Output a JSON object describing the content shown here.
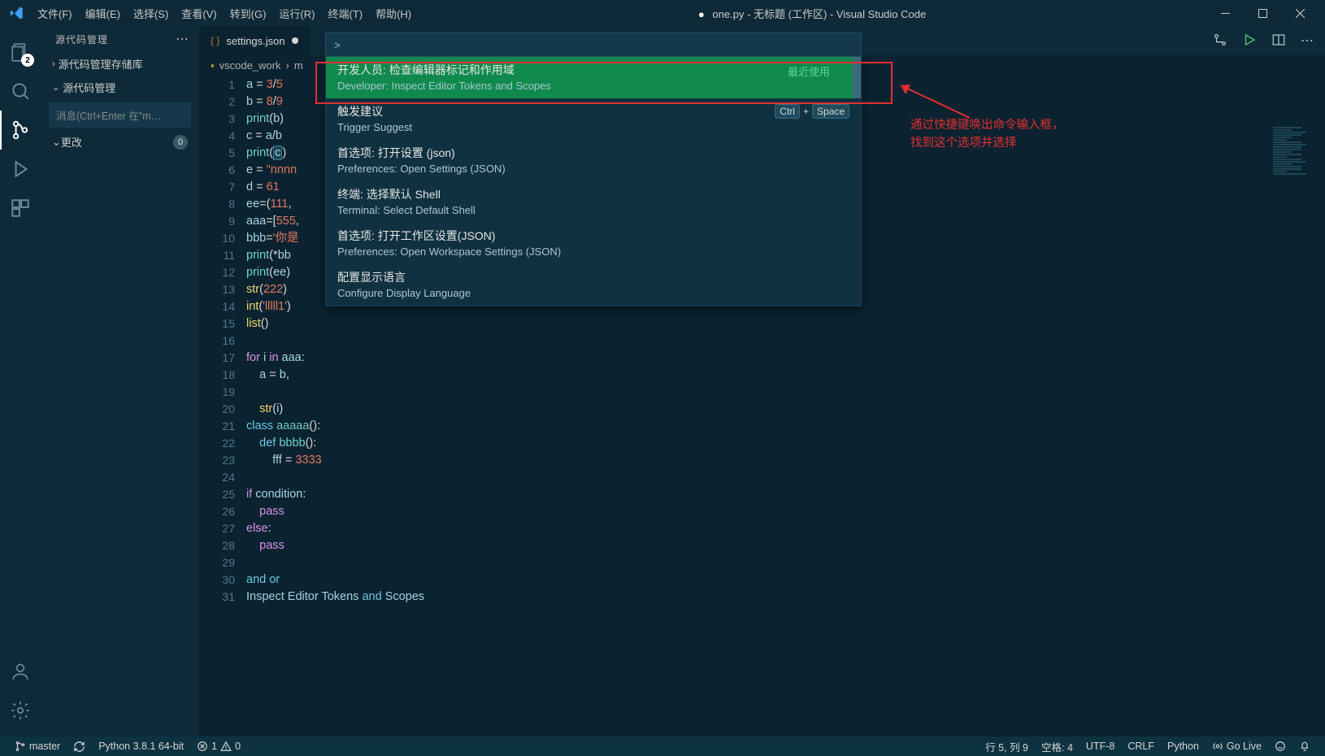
{
  "title": {
    "filename": "one.py",
    "workspace": "无标题 (工作区)",
    "app": "Visual Studio Code"
  },
  "menu": [
    "文件(F)",
    "编辑(E)",
    "选择(S)",
    "查看(V)",
    "转到(G)",
    "运行(R)",
    "终端(T)",
    "帮助(H)"
  ],
  "activity": {
    "explorer_badge": "2"
  },
  "sidebar": {
    "title": "源代码管理",
    "repo_section": "源代码管理存储库",
    "scm_section": "源代码管理",
    "message_placeholder": "消息(Ctrl+Enter 在\"m…",
    "changes_label": "更改",
    "changes_count": "0"
  },
  "tabs": {
    "settings": "settings.json"
  },
  "breadcrumb": {
    "folder": "vscode_work",
    "file_prefix": "m"
  },
  "palette": {
    "prefix": ">",
    "recent_label": "最近使用",
    "items": [
      {
        "cn": "开发人员: 检查编辑器标记和作用域",
        "en": "Developer: Inspect Editor Tokens and Scopes",
        "selected": true
      },
      {
        "cn": "触发建议",
        "en": "Trigger Suggest",
        "kbd": [
          "Ctrl",
          "Space"
        ]
      },
      {
        "cn": "首选项: 打开设置 (json)",
        "en": "Preferences: Open Settings (JSON)"
      },
      {
        "cn": "终端: 选择默认 Shell",
        "en": "Terminal: Select Default Shell"
      },
      {
        "cn": "首选项: 打开工作区设置(JSON)",
        "en": "Preferences: Open Workspace Settings (JSON)"
      },
      {
        "cn": "配置显示语言",
        "en": "Configure Display Language"
      }
    ]
  },
  "annotation": {
    "line1": "通过快捷键唤出命令输入框，",
    "line2": "找到这个选项并选择"
  },
  "code_lines": [
    [
      [
        "var",
        "a"
      ],
      [
        "op",
        " = "
      ],
      [
        "num",
        "3"
      ],
      [
        "op",
        "/"
      ],
      [
        "num",
        "5"
      ]
    ],
    [
      [
        "var",
        "b"
      ],
      [
        "op",
        " = "
      ],
      [
        "num",
        "8"
      ],
      [
        "op",
        "/"
      ],
      [
        "num",
        "9"
      ]
    ],
    [
      [
        "fn",
        "print"
      ],
      [
        "plain",
        "("
      ],
      [
        "var",
        "b"
      ],
      [
        "plain",
        ")"
      ]
    ],
    [
      [
        "var",
        "c"
      ],
      [
        "op",
        " = "
      ],
      [
        "var",
        "a"
      ],
      [
        "op",
        "/"
      ],
      [
        "var",
        "b"
      ]
    ],
    [
      [
        "fn",
        "print"
      ],
      [
        "plain",
        "("
      ],
      [
        "hl",
        "c"
      ],
      [
        "plain",
        ")"
      ]
    ],
    [
      [
        "var",
        "e"
      ],
      [
        "op",
        " = "
      ],
      [
        "str",
        "\"nnnn"
      ]
    ],
    [
      [
        "var",
        "d"
      ],
      [
        "op",
        " = "
      ],
      [
        "num",
        "61"
      ]
    ],
    [
      [
        "var",
        "ee"
      ],
      [
        "op",
        "="
      ],
      [
        "plain",
        "("
      ],
      [
        "num",
        "111"
      ],
      [
        "plain",
        ","
      ]
    ],
    [
      [
        "var",
        "aaa"
      ],
      [
        "op",
        "="
      ],
      [
        "plain",
        "["
      ],
      [
        "num",
        "555"
      ],
      [
        "plain",
        ","
      ]
    ],
    [
      [
        "var",
        "bbb"
      ],
      [
        "op",
        "="
      ],
      [
        "str",
        "'你是"
      ]
    ],
    [
      [
        "fn",
        "print"
      ],
      [
        "plain",
        "(*"
      ],
      [
        "var",
        "bb"
      ]
    ],
    [
      [
        "fn",
        "print"
      ],
      [
        "plain",
        "("
      ],
      [
        "var",
        "ee"
      ],
      [
        "plain",
        ")"
      ]
    ],
    [
      [
        "fn2",
        "str"
      ],
      [
        "plain",
        "("
      ],
      [
        "num",
        "222"
      ],
      [
        "plain",
        ")"
      ]
    ],
    [
      [
        "fn2",
        "int"
      ],
      [
        "plain",
        "("
      ],
      [
        "str",
        "'lllll1'"
      ],
      [
        "plain",
        ")"
      ]
    ],
    [
      [
        "fn2",
        "list"
      ],
      [
        "plain",
        "()"
      ]
    ],
    [],
    [
      [
        "kw2",
        "for"
      ],
      [
        "plain",
        " "
      ],
      [
        "var",
        "i"
      ],
      [
        "plain",
        " "
      ],
      [
        "kw2",
        "in"
      ],
      [
        "plain",
        " "
      ],
      [
        "var",
        "aaa"
      ],
      [
        "plain",
        ":"
      ]
    ],
    [
      [
        "indent",
        "    "
      ],
      [
        "var",
        "a"
      ],
      [
        "op",
        " = "
      ],
      [
        "var",
        "b"
      ],
      [
        "plain",
        ","
      ]
    ],
    [],
    [
      [
        "indent",
        "    "
      ],
      [
        "fn2",
        "str"
      ],
      [
        "plain",
        "("
      ],
      [
        "var",
        "i"
      ],
      [
        "plain",
        ")"
      ]
    ],
    [
      [
        "kw",
        "class"
      ],
      [
        "plain",
        " "
      ],
      [
        "cls",
        "aaaaa"
      ],
      [
        "plain",
        "():"
      ]
    ],
    [
      [
        "indent",
        "    "
      ],
      [
        "kw",
        "def"
      ],
      [
        "plain",
        " "
      ],
      [
        "fn",
        "bbbb"
      ],
      [
        "plain",
        "():"
      ]
    ],
    [
      [
        "indent",
        "        "
      ],
      [
        "var",
        "fff"
      ],
      [
        "op",
        " = "
      ],
      [
        "num",
        "3333"
      ]
    ],
    [],
    [
      [
        "kw2",
        "if"
      ],
      [
        "plain",
        " "
      ],
      [
        "var",
        "condition"
      ],
      [
        "plain",
        ":"
      ]
    ],
    [
      [
        "indent",
        "    "
      ],
      [
        "kw2",
        "pass"
      ]
    ],
    [
      [
        "kw2",
        "else"
      ],
      [
        "plain",
        ":"
      ]
    ],
    [
      [
        "indent",
        "    "
      ],
      [
        "kw2",
        "pass"
      ]
    ],
    [],
    [
      [
        "kw",
        "and"
      ],
      [
        "plain",
        " "
      ],
      [
        "kw",
        "or"
      ]
    ],
    [
      [
        "var",
        "Inspect"
      ],
      [
        "plain",
        " "
      ],
      [
        "var",
        "Editor"
      ],
      [
        "plain",
        " "
      ],
      [
        "var",
        "Tokens"
      ],
      [
        "plain",
        " "
      ],
      [
        "kw",
        "and"
      ],
      [
        "plain",
        " "
      ],
      [
        "var",
        "Scopes"
      ]
    ]
  ],
  "status": {
    "branch": "master",
    "python": "Python 3.8.1 64-bit",
    "errors": "1",
    "warnings": "0",
    "cursor": "行 5, 列 9",
    "spaces": "空格: 4",
    "encoding": "UTF-8",
    "eol": "CRLF",
    "lang": "Python",
    "golive": "Go Live"
  }
}
